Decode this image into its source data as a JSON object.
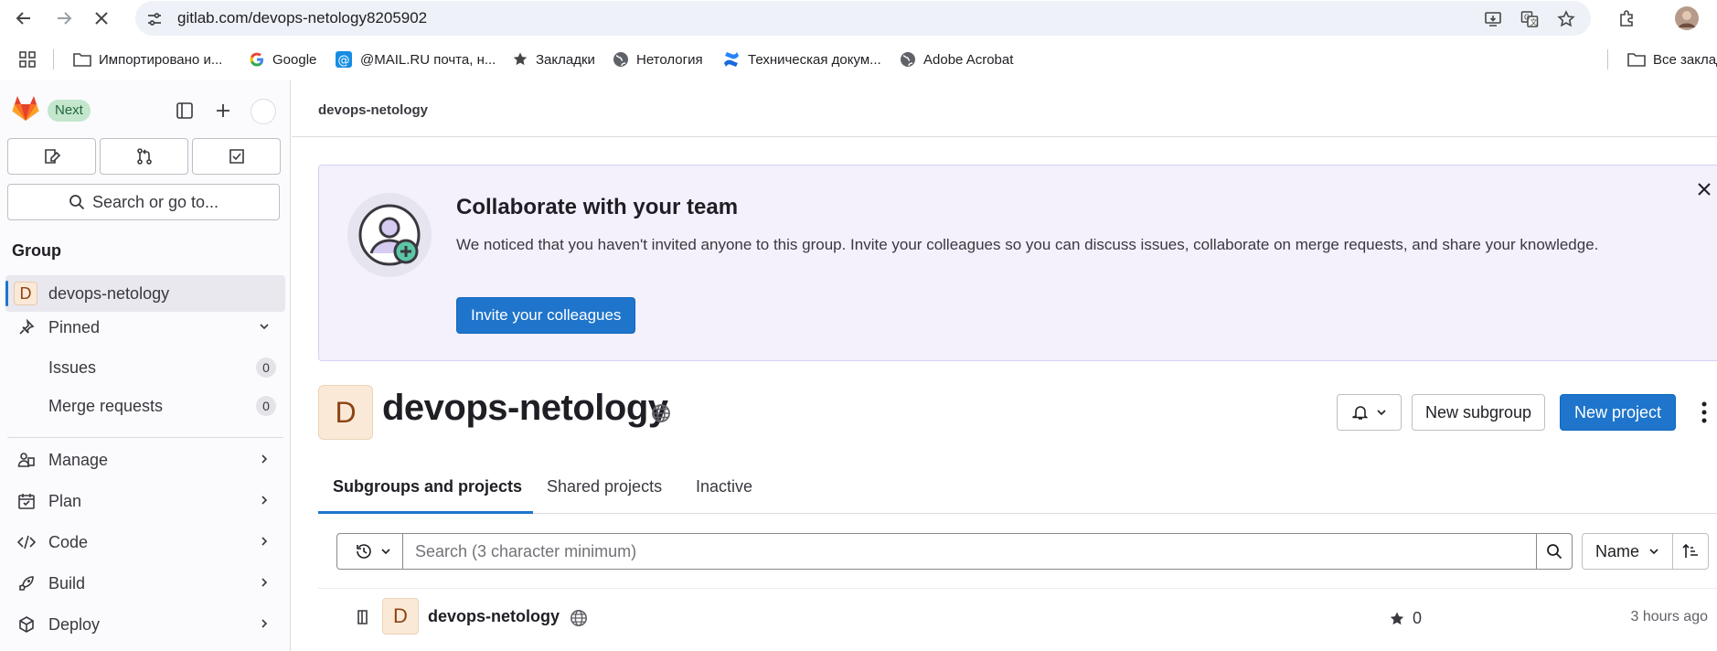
{
  "browser": {
    "url": "gitlab.com/devops-netology8205902",
    "bookmarks": [
      {
        "label": "Импортировано и...",
        "icon": "folder-icon"
      },
      {
        "label": "Google",
        "icon": "google-icon"
      },
      {
        "label": "@MAIL.RU почта, н...",
        "icon": "mailru-icon"
      },
      {
        "label": "Закладки",
        "icon": "star-icon"
      },
      {
        "label": "Нетология",
        "icon": "globe-icon"
      },
      {
        "label": "Техническая докум...",
        "icon": "confluence-icon"
      },
      {
        "label": "Adobe Acrobat",
        "icon": "globe-icon"
      }
    ],
    "all_bookmarks": "Все заклад"
  },
  "sidebar": {
    "next_badge": "Next",
    "search_label": "Search or go to...",
    "heading": "Group",
    "group_initial": "D",
    "group_name": "devops-netology",
    "pinned_label": "Pinned",
    "pinned": [
      {
        "label": "Issues",
        "count": "0"
      },
      {
        "label": "Merge requests",
        "count": "0"
      }
    ],
    "nav": [
      {
        "label": "Manage",
        "icon": "manage-icon"
      },
      {
        "label": "Plan",
        "icon": "plan-icon"
      },
      {
        "label": "Code",
        "icon": "code-icon"
      },
      {
        "label": "Build",
        "icon": "build-icon"
      },
      {
        "label": "Deploy",
        "icon": "deploy-icon"
      }
    ]
  },
  "main": {
    "breadcrumb": "devops-netology",
    "banner": {
      "title": "Collaborate with your team",
      "text": "We noticed that you haven't invited anyone to this group. Invite your colleagues so you can discuss issues, collaborate on merge requests, and share your knowledge.",
      "button": "Invite your colleagues"
    },
    "group": {
      "initial": "D",
      "title": "devops-netology",
      "new_subgroup": "New subgroup",
      "new_project": "New project"
    },
    "tabs": [
      "Subgroups and projects",
      "Shared projects",
      "Inactive"
    ],
    "filter": {
      "placeholder": "Search (3 character minimum)",
      "sort_label": "Name"
    },
    "projects": [
      {
        "initial": "D",
        "name": "devops-netology",
        "stars": "0",
        "updated": "3 hours ago"
      }
    ]
  },
  "colors": {
    "accent": "#1f75cb",
    "banner_bg": "#f4f0fc",
    "next_badge_bg": "#c3e6cd",
    "avatar_bg": "#fbe9d8"
  }
}
